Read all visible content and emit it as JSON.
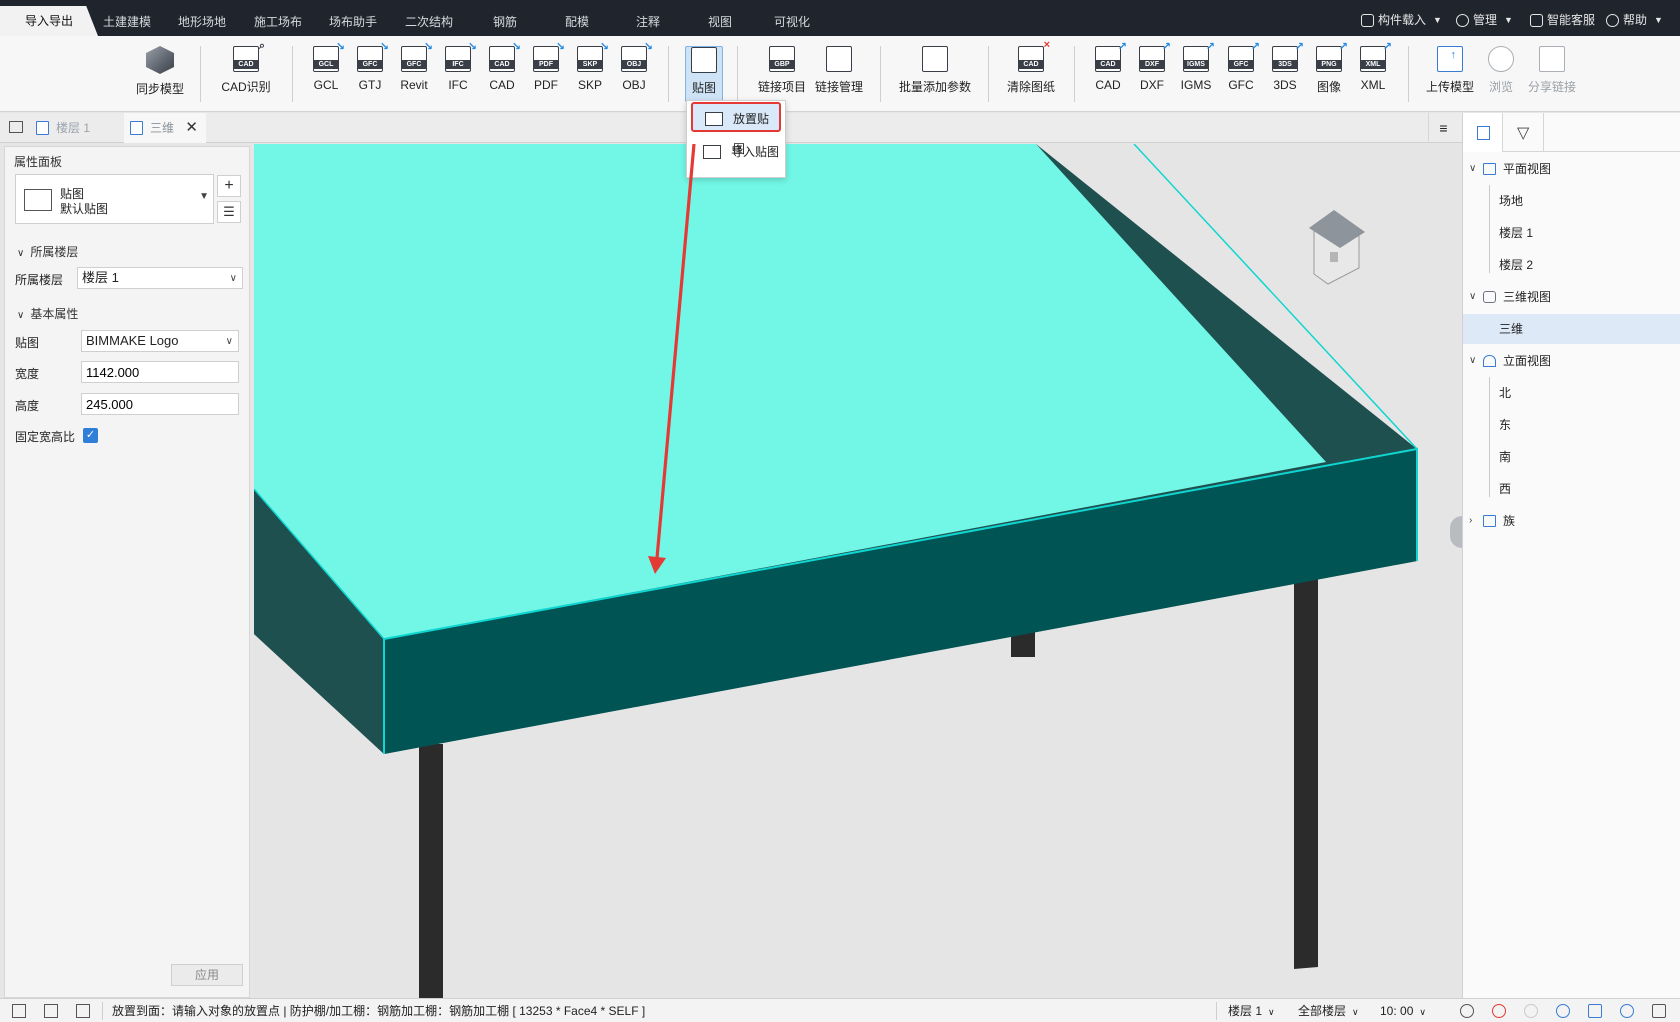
{
  "main_tabs": [
    {
      "label": "导入导出",
      "active": true
    },
    {
      "label": "土建建模"
    },
    {
      "label": "地形场地"
    },
    {
      "label": "施工场布"
    },
    {
      "label": "场布助手"
    },
    {
      "label": "二次结构"
    },
    {
      "label": "钢筋"
    },
    {
      "label": "配模"
    },
    {
      "label": "注释"
    },
    {
      "label": "视图"
    },
    {
      "label": "可视化"
    }
  ],
  "top_right": {
    "component_load": "构件载入",
    "manage": "管理",
    "smart_service": "智能客服",
    "help": "帮助"
  },
  "ribbon": {
    "sync_model": "同步模型",
    "cad_recognize": {
      "label": "CAD识别",
      "tag": "CAD"
    },
    "import_gcl": {
      "label": "GCL",
      "tag": "GCL"
    },
    "import_gtj": {
      "label": "GTJ",
      "tag": "GFC"
    },
    "import_revit": {
      "label": "Revit",
      "tag": "GFC"
    },
    "import_ifc": {
      "label": "IFC",
      "tag": "IFC"
    },
    "import_cad": {
      "label": "CAD",
      "tag": "CAD"
    },
    "import_pdf": {
      "label": "PDF",
      "tag": "PDF"
    },
    "import_skp": {
      "label": "SKP",
      "tag": "SKP"
    },
    "import_obj": {
      "label": "OBJ",
      "tag": "OBJ"
    },
    "decal": "贴图",
    "link_project": {
      "label": "链接项目",
      "tag": "GBP"
    },
    "link_manage": "链接管理",
    "batch_add_params": "批量添加参数",
    "clear_drawing": {
      "label": "清除图纸",
      "tag": "CAD"
    },
    "export_cad": {
      "label": "CAD",
      "tag": "CAD"
    },
    "export_dxf": {
      "label": "DXF",
      "tag": "DXF"
    },
    "export_igms": {
      "label": "IGMS",
      "tag": "IGMS"
    },
    "export_gfc": {
      "label": "GFC",
      "tag": "GFC"
    },
    "export_3ds": {
      "label": "3DS",
      "tag": "3DS"
    },
    "export_png": {
      "label": "图像",
      "tag": "PNG"
    },
    "export_xml": {
      "label": "XML",
      "tag": "XML"
    },
    "upload_model": "上传模型",
    "browse": "浏览",
    "share_link": "分享链接"
  },
  "dropdown": {
    "place_decal": "放置贴图",
    "import_decal": "导入贴图"
  },
  "doc_tabs": [
    {
      "label": "楼层 1"
    },
    {
      "label": "三维",
      "active": true
    }
  ],
  "property_panel": {
    "title": "属性面板",
    "type_name": "贴图",
    "type_sub": "默认贴图",
    "section_floor": "所属楼层",
    "floor_label": "所属楼层",
    "floor_value": "楼层 1",
    "section_basic": "基本属性",
    "decal_label": "贴图",
    "decal_value": "BIMMAKE Logo",
    "width_label": "宽度",
    "width_value": "1142.000",
    "height_label": "高度",
    "height_value": "245.000",
    "fix_ratio_label": "固定宽高比",
    "fix_ratio_checked": true,
    "apply": "应用"
  },
  "tree": {
    "plan_views": "平面视图",
    "plan_items": [
      "场地",
      "楼层 1",
      "楼层 2"
    ],
    "views_3d": "三维视图",
    "items_3d": [
      "三维"
    ],
    "elevation_views": "立面视图",
    "elevation_items": [
      "北",
      "东",
      "南",
      "西"
    ],
    "family": "族"
  },
  "statusbar": {
    "message": "放置到面：请输入对象的放置点 | 防护棚/加工棚：钢筋加工棚：钢筋加工棚 [ 13253 * Face4 * SELF ]",
    "floor": "楼层 1",
    "all_floors": "全部楼层",
    "time": "10: 00"
  },
  "colors": {
    "slab_top": "#72f7e6",
    "slab_front": "#005454",
    "slab_side": "#1f5050",
    "slab_edge": "#0fd6d0",
    "highlight_red": "#e53935",
    "accent_blue": "#2f7fd8"
  }
}
